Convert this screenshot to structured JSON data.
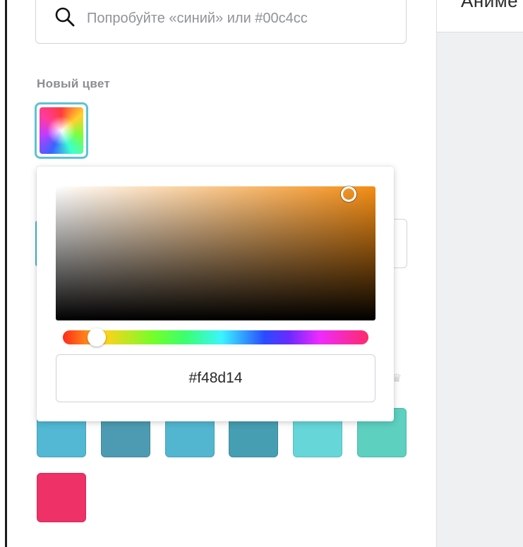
{
  "search": {
    "placeholder": "Попробуйте «синий» или #00c4cc",
    "value": "",
    "icon": "search-icon"
  },
  "right_tab": {
    "label": "Анимé"
  },
  "new_color": {
    "label": "Новый цвет"
  },
  "picker": {
    "hex_value": "#f48d14",
    "base_color": "#f48d14",
    "hue_position": 0.08,
    "saturation": 0.92,
    "value": 0.96
  },
  "swatches": [
    {
      "color": "#52b8d4"
    },
    {
      "color": "#4d9bb2"
    },
    {
      "color": "#53b6d0"
    },
    {
      "color": "#469eb2"
    },
    {
      "color": "#66d6d9"
    },
    {
      "color": "#5dd0c0"
    },
    {
      "color": "#ee3166"
    }
  ],
  "colors": {
    "accent": "#5ec3d4",
    "right_panel_bg": "#eff0f2"
  }
}
